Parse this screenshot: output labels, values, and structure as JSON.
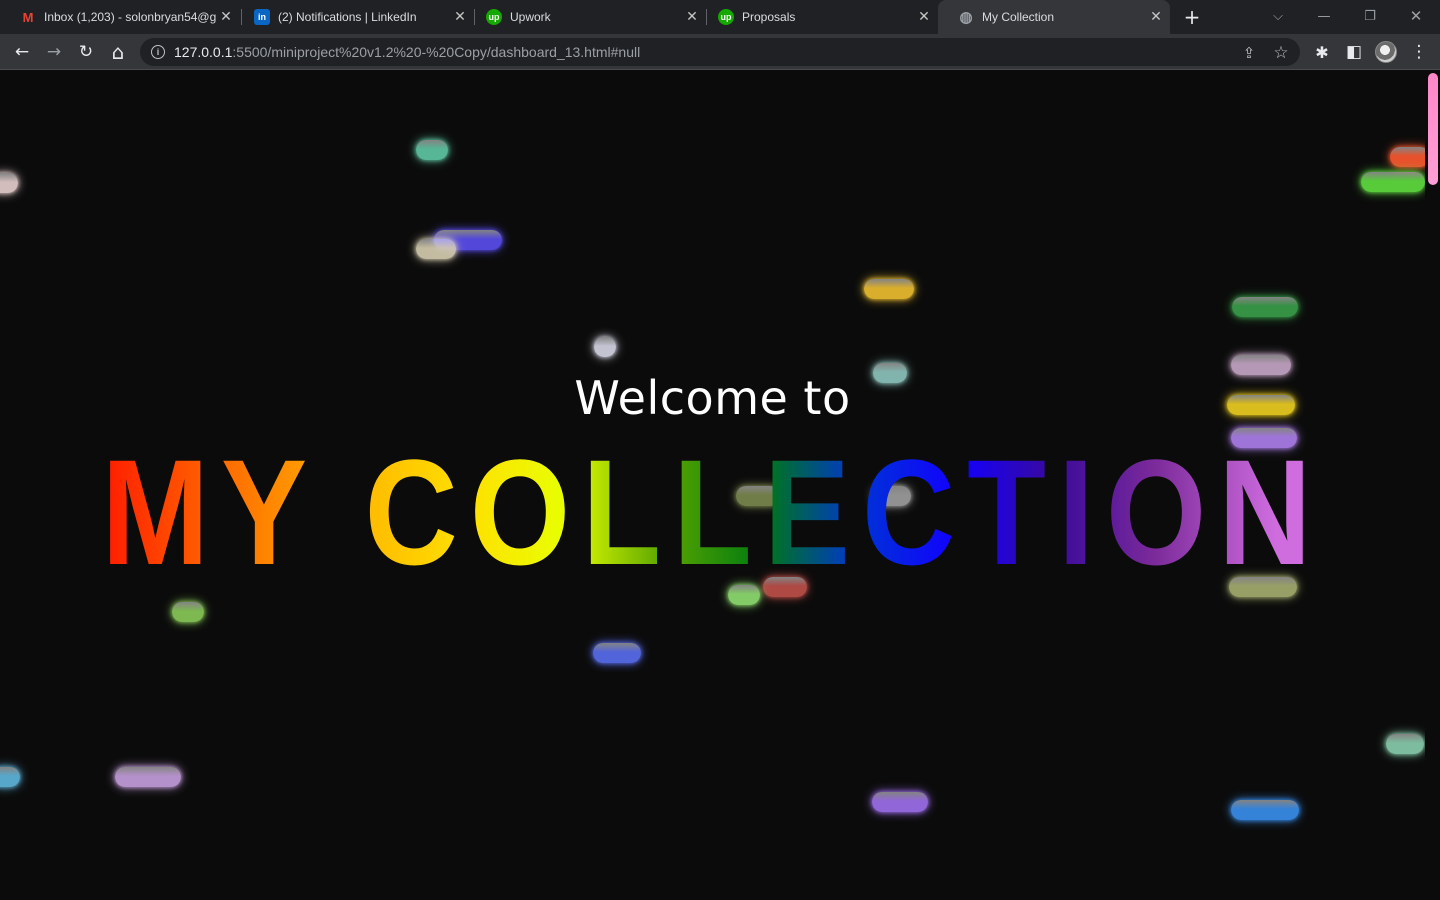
{
  "browser": {
    "tabs": [
      {
        "title": "Inbox (1,203) - solonbryan54@g",
        "icon": "gmail-icon",
        "icon_glyph": "M",
        "active": false
      },
      {
        "title": "(2) Notifications | LinkedIn",
        "icon": "linkedin-icon",
        "icon_glyph": "in",
        "active": false
      },
      {
        "title": "Upwork",
        "icon": "upwork-icon",
        "icon_glyph": "up",
        "active": false
      },
      {
        "title": "Proposals",
        "icon": "upwork-icon",
        "icon_glyph": "up",
        "active": false
      },
      {
        "title": "My Collection",
        "icon": "globe-icon",
        "icon_glyph": "◍",
        "active": true
      }
    ],
    "close_glyph": "✕",
    "new_tab_glyph": "+",
    "tab_search_glyph": "⌵",
    "minimize_glyph": "—",
    "restore_glyph": "❐",
    "window_close_glyph": "✕",
    "back_glyph": "←",
    "forward_glyph": "→",
    "reload_glyph": "↻",
    "home_glyph": "⌂",
    "info_glyph": "i",
    "url_host": "127.0.0.1",
    "url_rest": ":5500/miniproject%20v1.2%20-%20Copy/dashboard_13.html#null",
    "share_glyph": "⇪",
    "star_glyph": "☆",
    "extensions_glyph": "✱",
    "sidepanel_glyph": "◧",
    "menu_glyph": "⋮"
  },
  "page": {
    "welcome_text": "Welcome to",
    "heading": "MY COLLECTION",
    "colors": {
      "background": "#0b0b0b",
      "scroll_thumb": "#ff9fd6"
    }
  }
}
